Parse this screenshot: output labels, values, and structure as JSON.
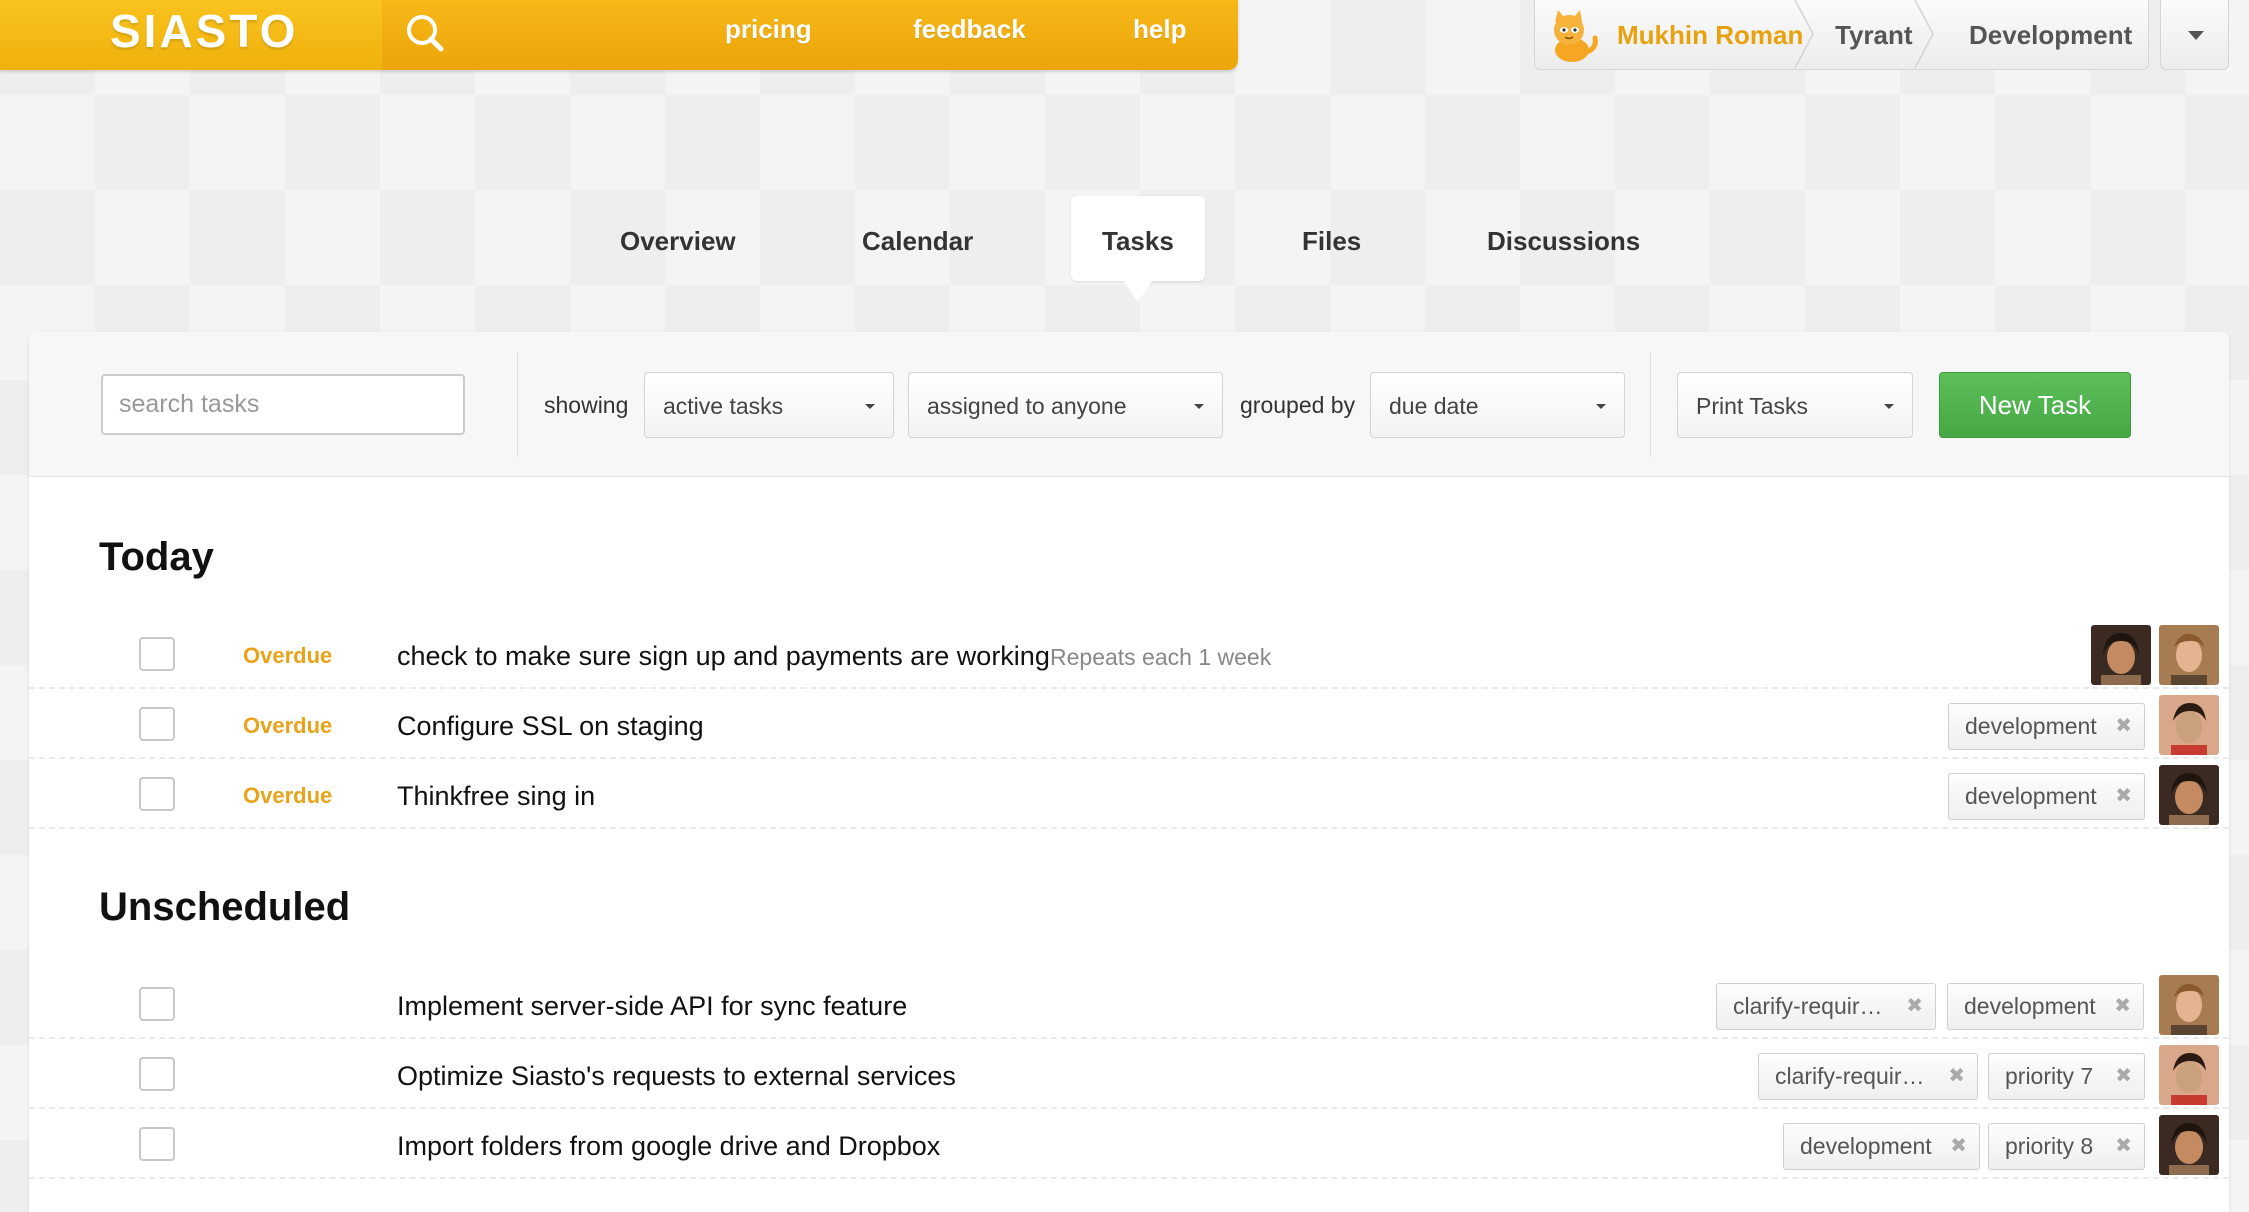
{
  "header": {
    "logo": "SIASTO",
    "nav": [
      {
        "label": "pricing"
      },
      {
        "label": "feedback"
      },
      {
        "label": "help"
      }
    ],
    "breadcrumb": {
      "user": "Mukhin Roman",
      "team": "Tyrant",
      "project": "Development"
    },
    "accent_color": "#f0b10c"
  },
  "tabs": [
    {
      "label": "Overview"
    },
    {
      "label": "Calendar"
    },
    {
      "label": "Tasks",
      "active": true
    },
    {
      "label": "Files"
    },
    {
      "label": "Discussions"
    }
  ],
  "toolbar": {
    "search_placeholder": "search tasks",
    "showing_label": "showing",
    "filter_status": "active tasks",
    "filter_assignee": "assigned to anyone",
    "grouped_label": "grouped by",
    "group_value": "due date",
    "print_label": "Print Tasks",
    "new_task_label": "New Task",
    "new_task_color": "#4db34b"
  },
  "groups": [
    {
      "title": "Today",
      "tasks": [
        {
          "status": "Overdue",
          "title": "check to make sure sign up and payments are working",
          "repeat": "Repeats each 1 week",
          "tags": [],
          "assignees": [
            "woman-1",
            "man-1"
          ]
        },
        {
          "status": "Overdue",
          "title": "Configure SSL on staging",
          "tags": [
            "development"
          ],
          "assignees": [
            "man-2"
          ]
        },
        {
          "status": "Overdue",
          "title": "Thinkfree sing in",
          "tags": [
            "development"
          ],
          "assignees": [
            "woman-1"
          ]
        }
      ]
    },
    {
      "title": "Unscheduled",
      "tasks": [
        {
          "title": "Implement server-side API for sync feature",
          "tags": [
            "clarify-requir…",
            "development"
          ],
          "assignees": [
            "man-1"
          ]
        },
        {
          "title": "Optimize Siasto's requests to external services",
          "tags": [
            "clarify-requir…",
            "priority 7"
          ],
          "assignees": [
            "man-2"
          ]
        },
        {
          "title": "Import folders from google drive and Dropbox",
          "tags": [
            "development",
            "priority 8"
          ],
          "assignees": [
            "woman-1"
          ]
        }
      ]
    }
  ],
  "tag_remove_glyph": "✖",
  "overdue_color": "#e8a31a"
}
